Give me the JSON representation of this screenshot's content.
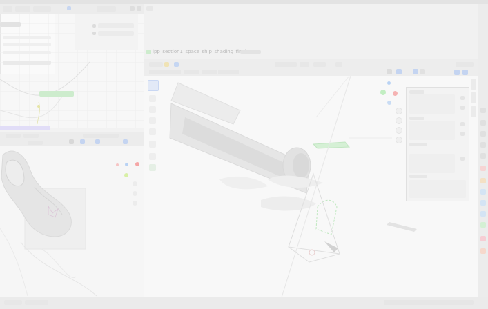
{
  "top_menu": {
    "items": [
      "",
      "",
      "",
      "",
      "",
      "",
      "",
      "",
      "",
      "",
      ""
    ]
  },
  "node_editor": {
    "node_label": "",
    "output_label": "",
    "fields": [
      "",
      "",
      "",
      ""
    ],
    "value": ""
  },
  "properties": {
    "field_a": "",
    "field_b": ""
  },
  "viewport_3d": {
    "file_title": "lpp_section1_space_ship_shading_final",
    "file_suffix": "",
    "camera_label": "",
    "mode_label": "",
    "view_label": ""
  },
  "uv_editor": {
    "header": ""
  },
  "status_bar": {
    "left": "",
    "mid": ""
  },
  "colors": {
    "gizmo_x": "#f25c5c",
    "gizmo_y": "#7dd87d",
    "gizmo_z": "#6aa8f0",
    "accent_green": "#6ee06e",
    "selection_purple": "#8c7ae6",
    "active_blue": "#3f7ff0"
  },
  "icons": {
    "right_toolbar": [
      "pointer-icon",
      "move-icon",
      "rotate-icon",
      "scale-icon",
      "transform-icon",
      "annotate-icon",
      "measure-icon",
      "cursor-icon"
    ],
    "side_strip": [
      "tool-icon",
      "view-icon",
      "item-icon",
      "render-icon",
      "world-icon",
      "object-icon",
      "modifier-icon",
      "particle-icon",
      "physics-icon",
      "constraint-icon",
      "data-icon",
      "material-icon",
      "texture-icon"
    ]
  }
}
